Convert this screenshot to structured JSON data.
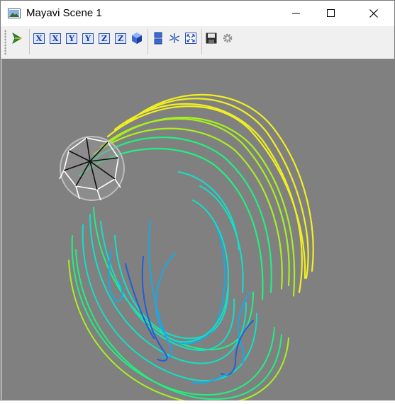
{
  "window": {
    "title": "Mayavi Scene 1",
    "controls": [
      "minimize",
      "maximize",
      "close"
    ]
  },
  "toolbar": {
    "items": [
      {
        "name": "pipeline-icon"
      },
      {
        "name": "view-x-plus",
        "label": "X"
      },
      {
        "name": "view-x-minus",
        "label": "X"
      },
      {
        "name": "view-y-plus",
        "label": "Y"
      },
      {
        "name": "view-y-minus",
        "label": "Y"
      },
      {
        "name": "view-z-plus",
        "label": "Z"
      },
      {
        "name": "view-z-minus",
        "label": "Z"
      },
      {
        "name": "isometric-view-icon"
      },
      {
        "name": "parallel-projection-icon"
      },
      {
        "name": "axes-indicator-icon"
      },
      {
        "name": "full-screen-icon"
      },
      {
        "name": "save-icon"
      },
      {
        "name": "configure-icon"
      }
    ]
  },
  "scene": {
    "background": "#808080",
    "colormap": [
      "#1f5fd8",
      "#19a8e8",
      "#10e0c8",
      "#20f080",
      "#a8f020",
      "#f0f020"
    ]
  }
}
